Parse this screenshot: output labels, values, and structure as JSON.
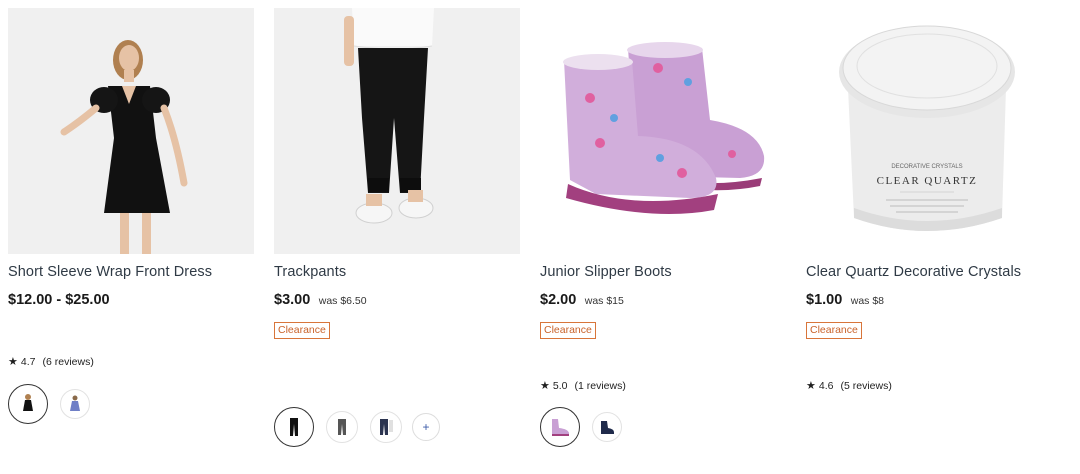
{
  "products": [
    {
      "title": "Short Sleeve Wrap Front Dress",
      "price": "$12.00 - $25.00",
      "was": "",
      "badge": "",
      "rating": "4.7",
      "reviews": "(6 reviews)",
      "image_icon": "dress-model-image",
      "swatches": [
        "black-dress-swatch",
        "blue-dress-swatch"
      ]
    },
    {
      "title": "Trackpants",
      "price": "$3.00",
      "was": "was $6.50",
      "badge": "Clearance",
      "rating": "",
      "reviews": "",
      "image_icon": "trackpants-model-image",
      "swatches": [
        "black-trackpants-swatch",
        "grey-trackpants-swatch",
        "navy-trackpants-swatch"
      ],
      "more_label": "+"
    },
    {
      "title": "Junior Slipper Boots",
      "price": "$2.00",
      "was": "was $15",
      "badge": "Clearance",
      "rating": "5.0",
      "reviews": "(1 reviews)",
      "image_icon": "slipper-boots-image",
      "swatches": [
        "lilac-boots-swatch",
        "navy-boots-swatch"
      ]
    },
    {
      "title": "Clear Quartz Decorative Crystals",
      "price": "$1.00",
      "was": "was $8",
      "badge": "Clearance",
      "rating": "4.6",
      "reviews": "(5 reviews)",
      "image_icon": "crystal-jar-image",
      "label_top": "DECORATIVE CRYSTALS",
      "label_main": "CLEAR QUARTZ",
      "swatches": []
    }
  ],
  "colors": {
    "clearance_border": "#d8753a",
    "clearance_text": "#c9622a",
    "price_text": "#1a1a1a"
  }
}
